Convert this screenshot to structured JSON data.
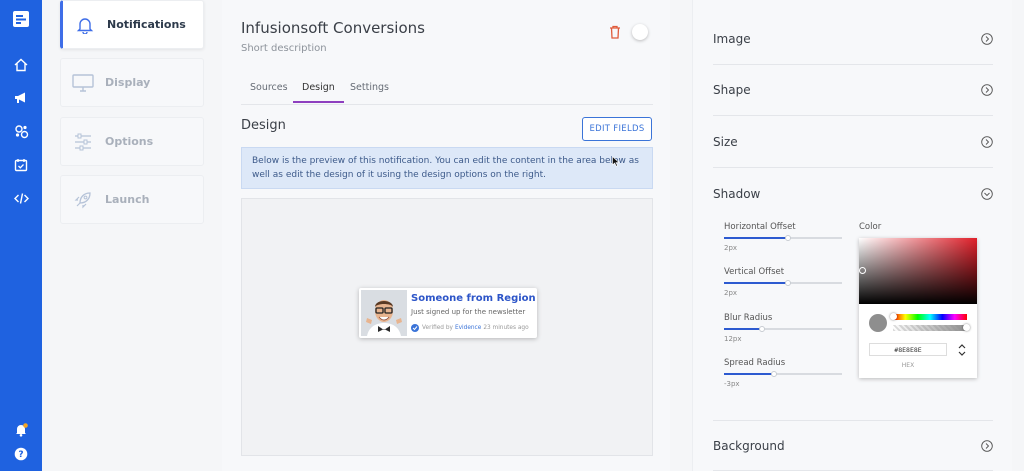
{
  "steps": [
    {
      "label": "Notifications",
      "icon": "bell-icon",
      "active": true
    },
    {
      "label": "Display",
      "icon": "monitor-icon",
      "active": false
    },
    {
      "label": "Options",
      "icon": "sliders-icon",
      "active": false
    },
    {
      "label": "Launch",
      "icon": "rocket-icon",
      "active": false
    }
  ],
  "main": {
    "title": "Infusionsoft Conversions",
    "subtitle": "Short description",
    "tabs": [
      {
        "label": "Sources",
        "active": false
      },
      {
        "label": "Design",
        "active": true
      },
      {
        "label": "Settings",
        "active": false
      }
    ],
    "section_title": "Design",
    "edit_fields_label": "EDIT FIELDS",
    "info_text": "Below is the preview of this notification. You can edit the content in the area below as well as edit the design of it using the design options on the right."
  },
  "notification": {
    "title": "Someone from Region",
    "message": "Just signed up for the newsletter",
    "verified_prefix": "Verified by",
    "verified_brand": "Evidence",
    "time_ago": "23 minutes ago"
  },
  "settings": {
    "sections": {
      "image": "Image",
      "shape": "Shape",
      "size": "Size",
      "shadow": "Shadow",
      "background": "Background"
    },
    "shadow": {
      "horizontal_offset": {
        "label": "Horizontal Offset",
        "value": "2px",
        "fill": 0.54
      },
      "vertical_offset": {
        "label": "Vertical Offset",
        "value": "2px",
        "fill": 0.54
      },
      "blur_radius": {
        "label": "Blur Radius",
        "value": "12px",
        "fill": 0.32
      },
      "spread_radius": {
        "label": "Spread Radius",
        "value": "-3px",
        "fill": 0.42
      },
      "color_label": "Color",
      "hex_value": "#8E8E8E",
      "hex_label": "HEX"
    }
  },
  "colors": {
    "rail": "#1f62e0",
    "accent": "#3b74d8",
    "tab_underline": "#8e3fbf",
    "shadow_color": "#8e8e8e"
  }
}
